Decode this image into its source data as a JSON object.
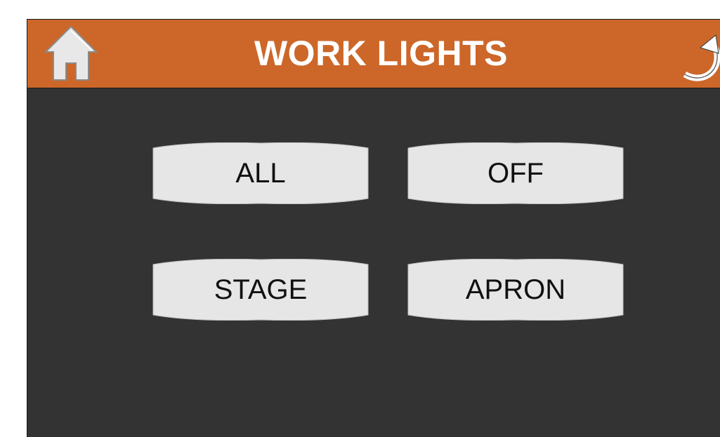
{
  "header": {
    "title": "WORK LIGHTS",
    "home_icon": "home-icon",
    "back_icon": "back-arrow-icon",
    "background_color": "#cc6729",
    "title_color": "#ffffff"
  },
  "buttons": [
    {
      "id": "all",
      "label": "ALL"
    },
    {
      "id": "off",
      "label": "OFF"
    },
    {
      "id": "stage",
      "label": "STAGE"
    },
    {
      "id": "apron",
      "label": "APRON"
    }
  ],
  "colors": {
    "panel_background": "#333333",
    "button_fill": "#e6e6e6",
    "button_text": "#111111"
  }
}
